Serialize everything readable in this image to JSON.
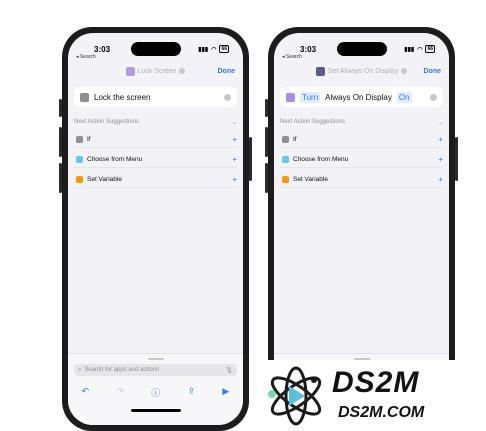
{
  "left": {
    "time": "3:03",
    "back": "◂ Search",
    "nav_title": "Lock Screen",
    "done": "Done",
    "action": "Lock the screen",
    "suggestions_header": "Next Action Suggestions",
    "suggestions": [
      {
        "label": "If"
      },
      {
        "label": "Choose from Menu"
      },
      {
        "label": "Set Variable"
      }
    ],
    "search_placeholder": "Search for apps and actions"
  },
  "right": {
    "time": "3:03",
    "back": "◂ Search",
    "nav_title": "Set Always On Display",
    "done": "Done",
    "action_verb": "Turn",
    "action_object": "Always On Display",
    "action_state": "On",
    "suggestions_header": "Next Action Suggestions",
    "suggestions": [
      {
        "label": "If"
      },
      {
        "label": "Choose from Menu"
      },
      {
        "label": "Set Variable"
      }
    ]
  },
  "battery": "66",
  "colors": {
    "accent": "#2f7bf5",
    "screen_bg": "#f2f2f7"
  }
}
